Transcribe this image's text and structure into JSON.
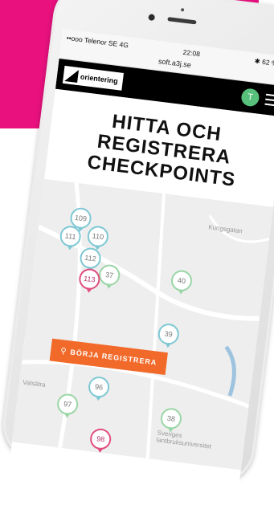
{
  "status": {
    "carrier": "••ooo Telenor SE",
    "network": "4G",
    "time": "22:08",
    "battery": "62 %"
  },
  "browser": {
    "url": "soft.a3j.se"
  },
  "nav": {
    "logo_text": "orientering",
    "avatar_initial": "T"
  },
  "hero": {
    "title": "HITTA OCH\nREGISTRERA\nCHECKPOINTS"
  },
  "cta": {
    "label": "BÖRJA REGISTRERA"
  },
  "map": {
    "labels": {
      "place": "Valsätra",
      "university": "Sveriges\nlantbruksuniversitet",
      "road": "Kungsgatan"
    },
    "checkpoints": [
      {
        "id": "109",
        "color": "blue"
      },
      {
        "id": "111",
        "color": "blue"
      },
      {
        "id": "110",
        "color": "blue"
      },
      {
        "id": "112",
        "color": "blue"
      },
      {
        "id": "37",
        "color": "green"
      },
      {
        "id": "113",
        "color": "red"
      },
      {
        "id": "40",
        "color": "green"
      },
      {
        "id": "39",
        "color": "blue"
      },
      {
        "id": "96",
        "color": "blue"
      },
      {
        "id": "97",
        "color": "green"
      },
      {
        "id": "38",
        "color": "green"
      },
      {
        "id": "98",
        "color": "red"
      }
    ]
  },
  "colors": {
    "magenta": "#e8117e",
    "cta": "#f26a2a",
    "avatar": "#57c07b"
  }
}
